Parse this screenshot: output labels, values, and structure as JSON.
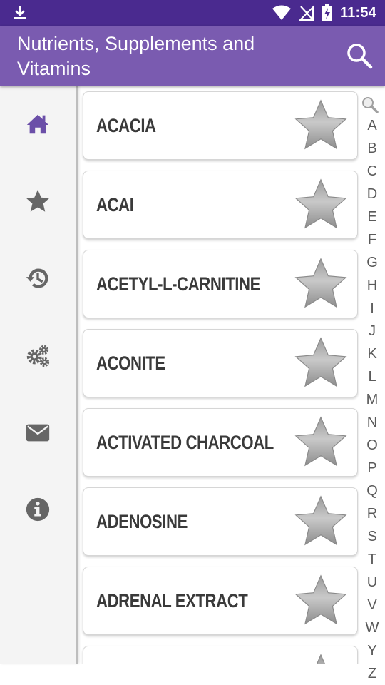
{
  "status_bar": {
    "time": "11:54"
  },
  "app_bar": {
    "title": "Nutrients, Supplements and Vitamins"
  },
  "nav": {
    "items": [
      {
        "name": "home",
        "icon": "home-icon",
        "active": true
      },
      {
        "name": "favorites",
        "icon": "star-icon"
      },
      {
        "name": "history",
        "icon": "history-icon"
      },
      {
        "name": "settings",
        "icon": "gears-icon"
      },
      {
        "name": "contact",
        "icon": "mail-icon"
      },
      {
        "name": "info",
        "icon": "info-icon"
      }
    ]
  },
  "list": {
    "items": [
      {
        "name": "ACACIA"
      },
      {
        "name": "ACAI"
      },
      {
        "name": "ACETYL-L-CARNITINE"
      },
      {
        "name": "ACONITE"
      },
      {
        "name": "ACTIVATED CHARCOAL"
      },
      {
        "name": "ADENOSINE"
      },
      {
        "name": "ADRENAL EXTRACT"
      },
      {
        "name": ""
      }
    ]
  },
  "alphabet": [
    "A",
    "B",
    "C",
    "D",
    "E",
    "F",
    "G",
    "H",
    "I",
    "J",
    "K",
    "L",
    "M",
    "N",
    "O",
    "P",
    "Q",
    "R",
    "S",
    "T",
    "U",
    "V",
    "W",
    "Y",
    "Z"
  ],
  "colors": {
    "status_bar": "#4a2a8f",
    "app_bar": "#7a5bb0",
    "active_nav": "#6b4fa8",
    "icon_gray": "#666666"
  }
}
